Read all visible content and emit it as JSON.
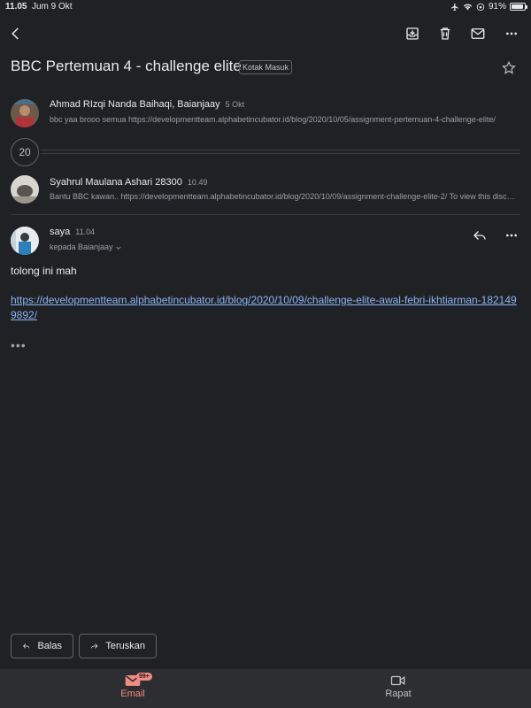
{
  "status_bar": {
    "time": "11.05",
    "date": "Jum 9 Okt",
    "battery": "91%"
  },
  "subject": {
    "title": "BBC Pertemuan 4 - challenge elite",
    "label": "Kotak Masuk"
  },
  "messages": [
    {
      "sender": "Ahmad RIzqi Nanda Baihaqi, Baianjaay",
      "time": "5 Okt",
      "snippet": "bbc yaa brooo semua https://developmentteam.alphabetincubator.id/blog/2020/10/05/assignment-pertemuan-4-challenge-elite/"
    },
    {
      "sender": "Syahrul Maulana Ashari 28300",
      "time": "10.49",
      "snippet": "Bantu BBC kawan.. https://developmentteam.alphabetincubator.id/blog/2020/10/09/assignment-challenge-elite-2/ To view this discussion"
    }
  ],
  "collapsed_count": "20",
  "expanded": {
    "sender": "saya",
    "time": "11.04",
    "recipient": "kepada Baianjaay",
    "body": "tolong ini mah",
    "link": "https://developmentteam.alphabetincubator.id/blog/2020/10/09/challenge-elite-awal-febri-ikhtiarman-1821499892/",
    "more": "•••"
  },
  "actions": {
    "reply": "Balas",
    "forward": "Teruskan"
  },
  "nav": {
    "email": "Email",
    "email_badge": "99+",
    "meet": "Rapat"
  },
  "colors": {
    "background": "#202124",
    "link": "#8ab4f8",
    "accent": "#f28b82"
  }
}
